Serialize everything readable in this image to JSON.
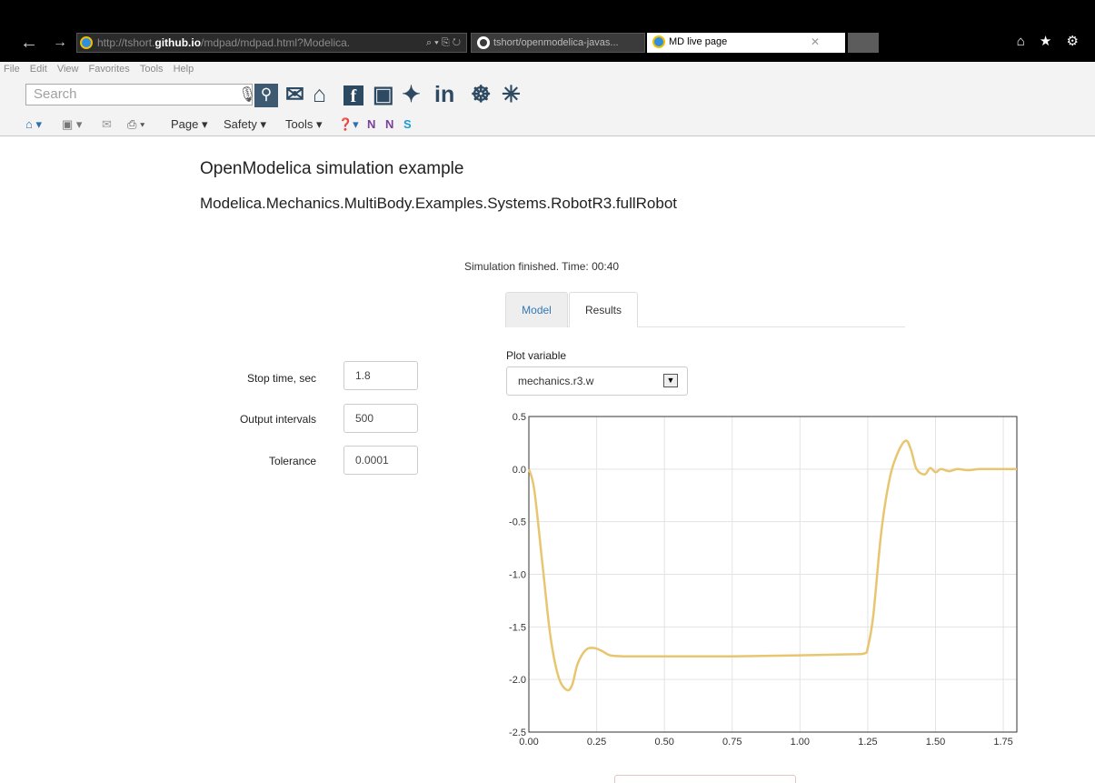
{
  "browser": {
    "url_prefix": "http://tshort.",
    "url_domain": "github.io",
    "url_rest": "/mdpad/mdpad.html?Modelica.",
    "url_controls": "⌕ ▾ ⎘ ↻",
    "tabs": [
      {
        "label": "tshort/openmodelica-javas..."
      },
      {
        "label": "MD live page",
        "active": true
      }
    ],
    "right_icons": "⌂ ★ ⚙"
  },
  "menu": [
    "File",
    "Edit",
    "View",
    "Favorites",
    "Tools",
    "Help"
  ],
  "search": {
    "placeholder": "Search"
  },
  "social_icons": [
    "mail-icon",
    "home-icon",
    "facebook-icon",
    "youtube-icon",
    "twitter-icon",
    "linkedin-icon",
    "reddit-icon",
    "yelp-icon"
  ],
  "social_glyphs": {
    "mail": "✉",
    "home": "⌂",
    "facebook": "f",
    "youtube": "▣",
    "twitter": "✦",
    "linkedin": "in",
    "reddit": "☸",
    "yelp": "✳"
  },
  "command_bar": {
    "page": "Page ▾",
    "safety": "Safety ▾",
    "tools": "Tools ▾"
  },
  "page": {
    "title": "OpenModelica simulation example",
    "model": "Modelica.Mechanics.MultiBody.Examples.Systems.RobotR3.fullRobot",
    "status": "Simulation finished.  Time: 00:40",
    "tabs": {
      "model": "Model",
      "results": "Results"
    }
  },
  "form": {
    "stop_time": {
      "label": "Stop time, sec",
      "value": "1.8"
    },
    "output_intervals": {
      "label": "Output intervals",
      "value": "500"
    },
    "tolerance": {
      "label": "Tolerance",
      "value": "0.0001"
    }
  },
  "plot_variable": {
    "label": "Plot variable",
    "selected": "mechanics.r3.w"
  },
  "colors": {
    "series": "#e8c670",
    "grid": "#e3e3e3",
    "accent": "#337ab7"
  },
  "chart_data": {
    "type": "line",
    "xlim": [
      0,
      1.8
    ],
    "ylim": [
      -2.5,
      0.5
    ],
    "x_ticks": [
      "0.00",
      "0.25",
      "0.50",
      "0.75",
      "1.00",
      "1.25",
      "1.50",
      "1.75"
    ],
    "y_ticks": [
      "0.5",
      "0.0",
      "-0.5",
      "-1.0",
      "-1.5",
      "-2.0",
      "-2.5"
    ],
    "grid": true,
    "series": [
      {
        "x": [
          0,
          0.02,
          0.05,
          0.08,
          0.11,
          0.14,
          0.16,
          0.18,
          0.21,
          0.24,
          0.27,
          0.3,
          0.35,
          0.4,
          0.5,
          0.75,
          1.0,
          1.2,
          1.24,
          1.25,
          1.27,
          1.3,
          1.33,
          1.36,
          1.39,
          1.41,
          1.43,
          1.46,
          1.48,
          1.5,
          1.52,
          1.55,
          1.58,
          1.62,
          1.66,
          1.7,
          1.75,
          1.8
        ],
        "y": [
          0,
          -0.2,
          -0.9,
          -1.6,
          -1.98,
          -2.1,
          -2.05,
          -1.85,
          -1.72,
          -1.7,
          -1.73,
          -1.77,
          -1.78,
          -1.78,
          -1.78,
          -1.78,
          -1.77,
          -1.76,
          -1.75,
          -1.7,
          -1.4,
          -0.6,
          -0.1,
          0.15,
          0.27,
          0.18,
          0.0,
          -0.05,
          0.01,
          -0.03,
          0.0,
          -0.02,
          0.0,
          -0.01,
          0.0,
          0.0,
          0.0,
          0.0
        ]
      }
    ]
  }
}
